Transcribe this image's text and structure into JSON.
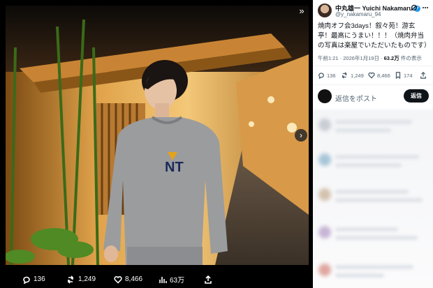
{
  "media": {
    "sweater_logo": "NT",
    "nav_icons": [
      "expand-icon",
      "next-arrow-icon"
    ]
  },
  "media_actions": {
    "replies": "136",
    "reposts": "1,249",
    "likes": "8,466",
    "views": "63万"
  },
  "tweet": {
    "author_name": "中丸雄一 Yuichi Nakamaru",
    "author_handle": "@y_nakamaru_94",
    "text": "焼肉オフ会3days！叙々苑！游玄亭！最高にうまい！！！（焼肉弁当の写真は楽屋でいただいたものです）",
    "time": "午前1:21 · 2026年1月19日 · ",
    "view_count": "63.2万",
    "view_suffix": " 件の表示"
  },
  "tweet_stats": {
    "replies": "136",
    "reposts": "1,249",
    "likes": "8,466",
    "bookmarks": "174"
  },
  "reply": {
    "placeholder": "返信をポスト",
    "button": "返信"
  },
  "colors": {
    "verified": "#1d9bf0",
    "text_primary": "#0f1419",
    "text_secondary": "#536471"
  }
}
